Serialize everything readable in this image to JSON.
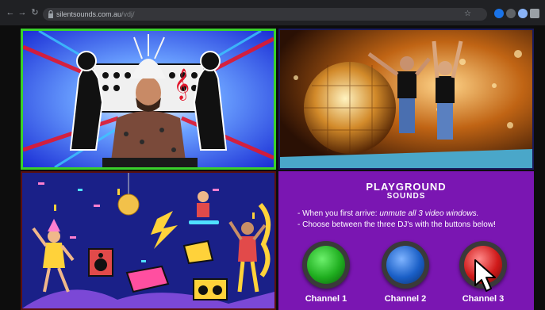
{
  "browser": {
    "url_host": "silentsounds.com.au",
    "url_path": "/vdj/"
  },
  "panels": {
    "top_left_border": "#39d12b"
  },
  "brand": {
    "line1": "PLAYGROUND",
    "line2": "SOUNDS"
  },
  "instructions": {
    "line1_prefix": "- When you first arrive: ",
    "line1_emph": "unmute all 3 video windows.",
    "line2": "- Choose between the three DJ's with the buttons below!"
  },
  "channels": [
    {
      "label": "Channel 1",
      "color": "#1fae1f"
    },
    {
      "label": "Channel 2",
      "color": "#1a5fc7"
    },
    {
      "label": "Channel 3",
      "color": "#d01a1a"
    }
  ],
  "icons": {
    "back": "arrow-left-icon",
    "forward": "arrow-right-icon",
    "reload": "reload-icon",
    "lock": "lock-icon",
    "bookmark": "star-icon",
    "cursor": "mouse-pointer-icon"
  }
}
